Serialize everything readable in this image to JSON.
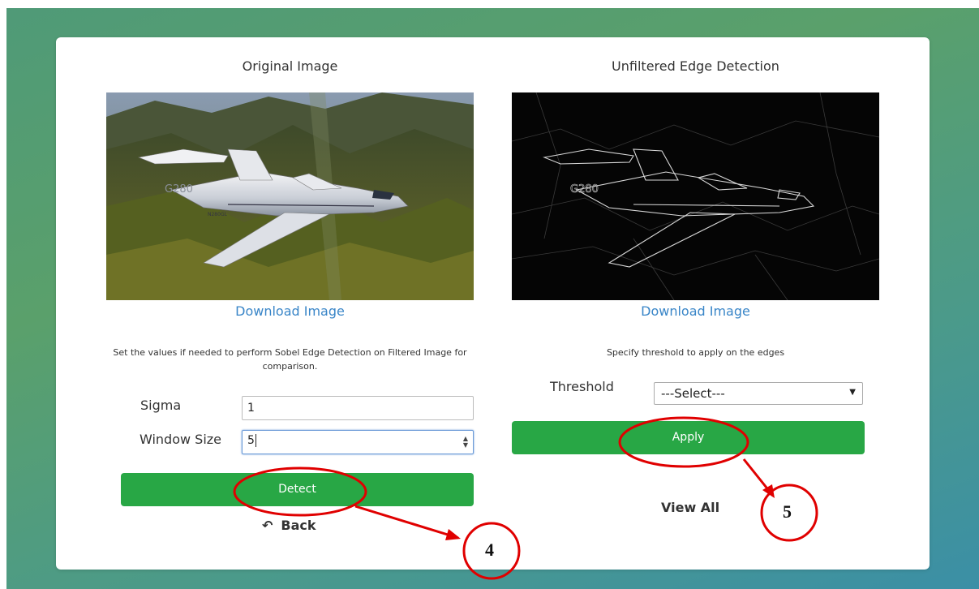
{
  "left_panel": {
    "title": "Original Image",
    "download_label": "Download Image",
    "hint": "Set the values if needed to perform Sobel Edge Detection on Filtered Image for comparison.",
    "sigma_label": "Sigma",
    "sigma_value": "1",
    "window_label": "Window Size",
    "window_value": "5",
    "detect_label": "Detect",
    "back_label": "Back"
  },
  "right_panel": {
    "title": "Unfiltered Edge Detection",
    "download_label": "Download Image",
    "hint": "Specify threshold to apply on the edges",
    "threshold_label": "Threshold",
    "threshold_selected": "---Select---",
    "apply_label": "Apply",
    "view_all_label": "View All"
  },
  "image_text": {
    "plane_model": "G280",
    "plane_reg": "N280GL"
  },
  "annotations": {
    "step_4": "4",
    "step_5": "5",
    "color": "#e00000"
  },
  "colors": {
    "button_green": "#28a745",
    "link_blue": "#3a86c8"
  }
}
